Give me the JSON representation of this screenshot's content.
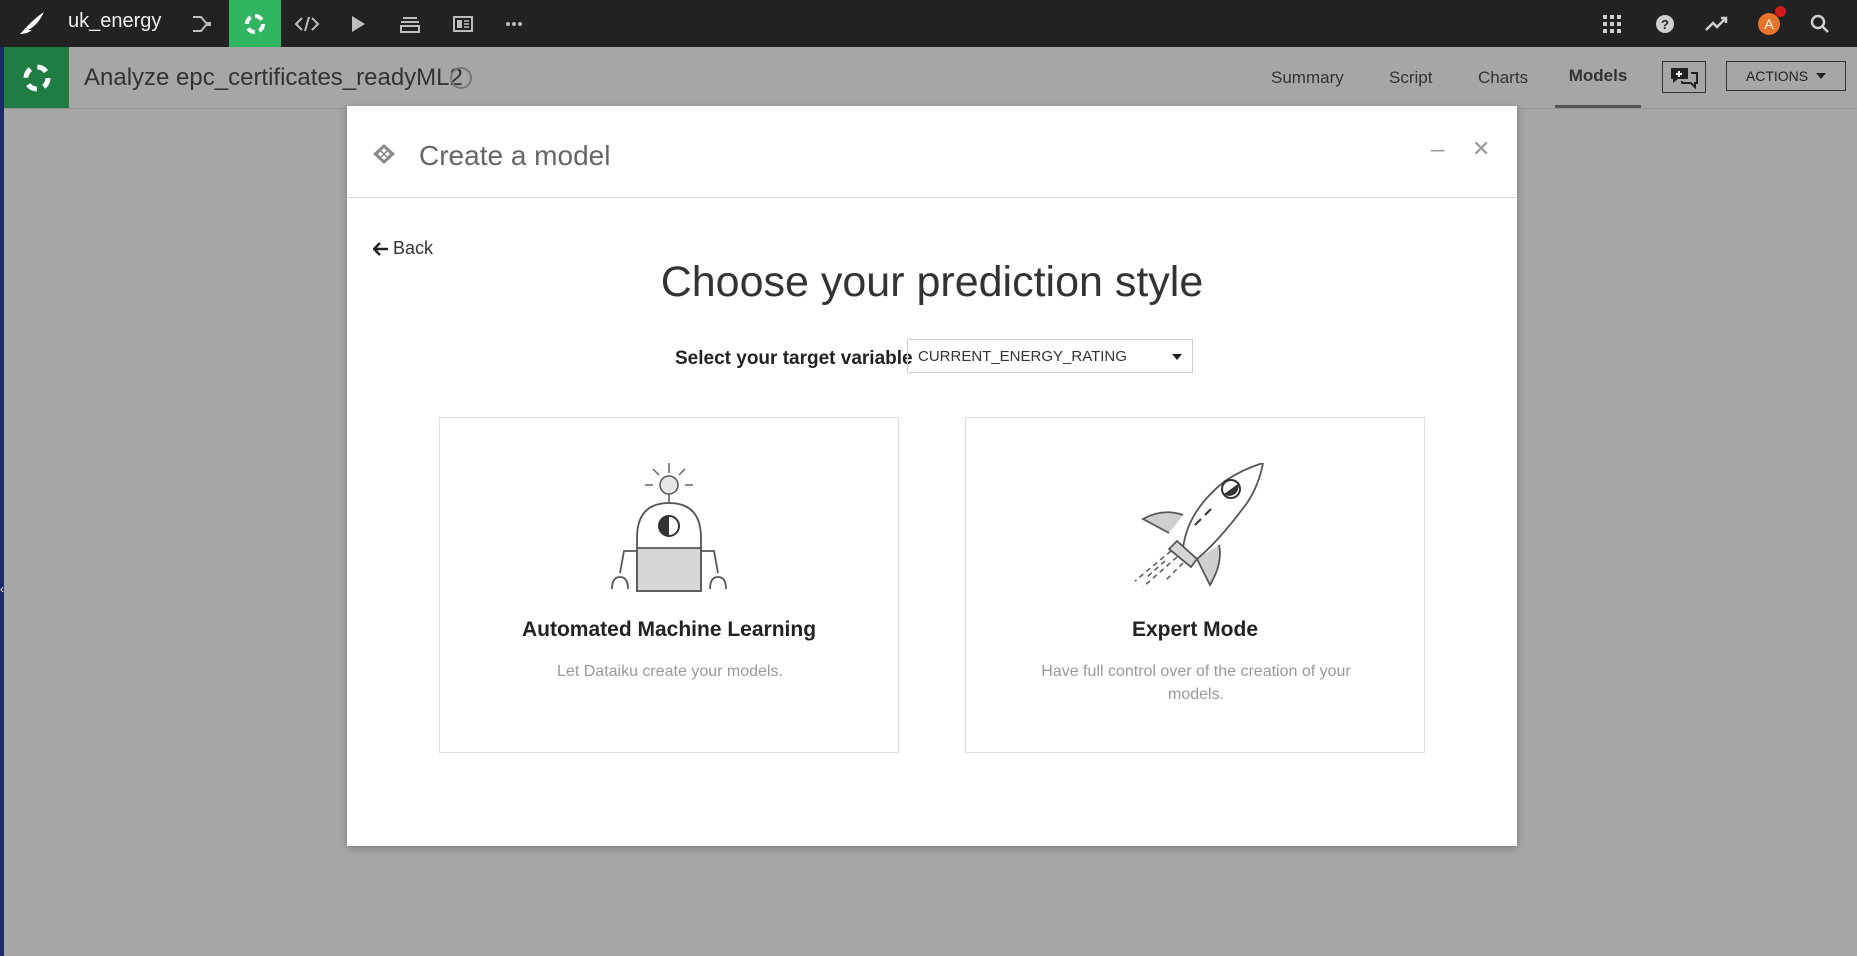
{
  "topbar": {
    "project_name": "uk_energy",
    "nav_icons": [
      "flow-icon",
      "analysis-icon",
      "code-icon",
      "run-icon",
      "datasets-icon",
      "dashboard-icon",
      "more-icon"
    ],
    "right_icons": [
      "apps-grid-icon",
      "help-icon",
      "activity-icon",
      "avatar-icon",
      "search-icon"
    ],
    "avatar_initial": "A",
    "accent": "#2fb55f"
  },
  "subheader": {
    "title": "Analyze epc_certificates_readyML2",
    "tabs": [
      "Summary",
      "Script",
      "Charts",
      "Models"
    ],
    "active_tab": "Models",
    "actions_label": "ACTIONS"
  },
  "modal": {
    "title": "Create a model",
    "back_label": "Back",
    "heading": "Choose your prediction style",
    "target_label": "Select your target variable",
    "target_value": "CURRENT_ENERGY_RATING",
    "cards": [
      {
        "title": "Automated Machine Learning",
        "description": "Let Dataiku create your models.",
        "icon": "robot-icon"
      },
      {
        "title": "Expert Mode",
        "description": "Have full control over of the creation of your models.",
        "icon": "rocket-icon"
      }
    ]
  }
}
